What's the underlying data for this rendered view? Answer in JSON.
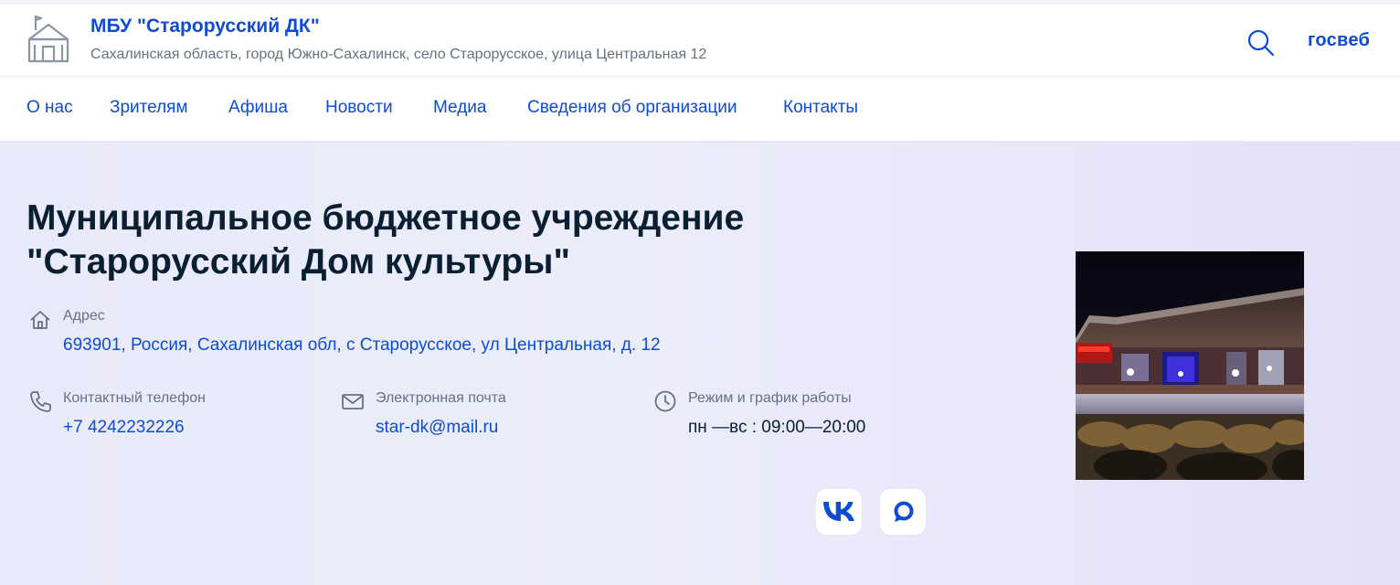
{
  "header": {
    "org_name": "МБУ \"Старорусский ДК\"",
    "org_address": "Сахалинская область, город Южно-Сахалинск, село Старорусское, улица Центральная 12",
    "brand": "госвеб"
  },
  "nav": {
    "items": [
      {
        "label": "О нас"
      },
      {
        "label": "Зрителям"
      },
      {
        "label": "Афиша"
      },
      {
        "label": "Новости"
      },
      {
        "label": "Медиа"
      },
      {
        "label": "Сведения об организации"
      },
      {
        "label": "Контакты"
      }
    ]
  },
  "hero": {
    "title_line1": "Муниципальное бюджетное учреждение",
    "title_line2": "\"Старорусский Дом культуры\"",
    "address_label": "Адрес",
    "address_value": "693901, Россия, Сахалинская обл, с Старорусское, ул Центральная, д. 12",
    "phone_label": "Контактный телефон",
    "phone_value": "+7 4242232226",
    "email_label": "Электронная почта",
    "email_value": "star-dk@mail.ru",
    "hours_label": "Режим и график работы",
    "hours_value": "пн —вс : 09:00—20:00"
  },
  "colors": {
    "accent": "#0d4cd3",
    "text": "#0b1f33",
    "muted": "#66727f",
    "hero_bg": "#eaeafa"
  },
  "icons": {
    "logo": "building-icon",
    "search": "search-icon",
    "address": "home-icon",
    "phone": "phone-icon",
    "email": "mail-icon",
    "hours": "clock-icon",
    "social": [
      "vk-icon",
      "chat-bubble-icon"
    ]
  }
}
